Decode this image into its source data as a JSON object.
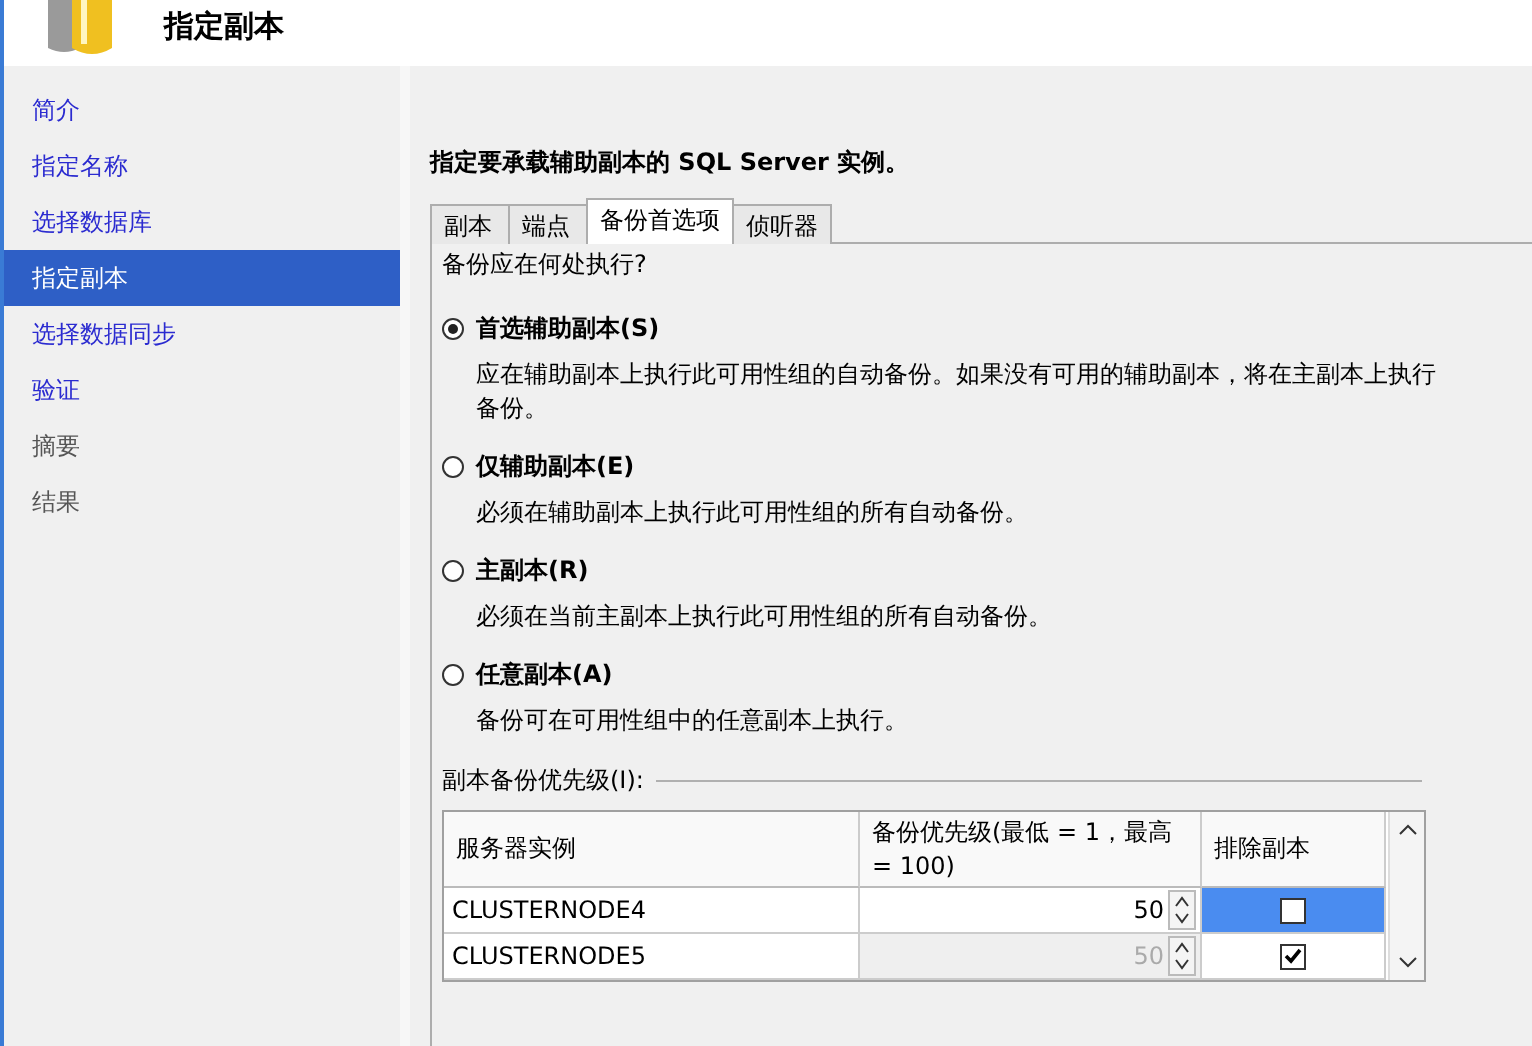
{
  "header": {
    "title": "指定副本"
  },
  "sidebar": {
    "items": [
      {
        "label": "简介",
        "selected": false,
        "disabled": false
      },
      {
        "label": "指定名称",
        "selected": false,
        "disabled": false
      },
      {
        "label": "选择数据库",
        "selected": false,
        "disabled": false
      },
      {
        "label": "指定副本",
        "selected": true,
        "disabled": false
      },
      {
        "label": "选择数据同步",
        "selected": false,
        "disabled": false
      },
      {
        "label": "验证",
        "selected": false,
        "disabled": false
      },
      {
        "label": "摘要",
        "selected": false,
        "disabled": true
      },
      {
        "label": "结果",
        "selected": false,
        "disabled": true
      }
    ]
  },
  "instruction": "指定要承载辅助副本的 SQL Server 实例。",
  "tabs": [
    {
      "label": "副本",
      "selected": false
    },
    {
      "label": "端点",
      "selected": false
    },
    {
      "label": "备份首选项",
      "selected": true
    },
    {
      "label": "侦听器",
      "selected": false
    }
  ],
  "question": "备份应在何处执行?",
  "options": [
    {
      "label": "首选辅助副本(S)",
      "description": "应在辅助副本上执行此可用性组的自动备份。如果没有可用的辅助副本，将在主副本上执行备份。",
      "selected": true
    },
    {
      "label": "仅辅助副本(E)",
      "description": "必须在辅助副本上执行此可用性组的所有自动备份。",
      "selected": false
    },
    {
      "label": "主副本(R)",
      "description": "必须在当前主副本上执行此可用性组的所有自动备份。",
      "selected": false
    },
    {
      "label": "任意副本(A)",
      "description": "备份可在可用性组中的任意副本上执行。",
      "selected": false
    }
  ],
  "priority_group": {
    "label": "副本备份优先级(I):",
    "columns": [
      "服务器实例",
      "备份优先级(最低 = 1，最高 = 100)",
      "排除副本"
    ],
    "rows": [
      {
        "server": "CLUSTERNODE4",
        "priority": "50",
        "exclude": false,
        "selected": true
      },
      {
        "server": "CLUSTERNODE5",
        "priority": "50",
        "exclude": true,
        "selected": false
      }
    ]
  }
}
